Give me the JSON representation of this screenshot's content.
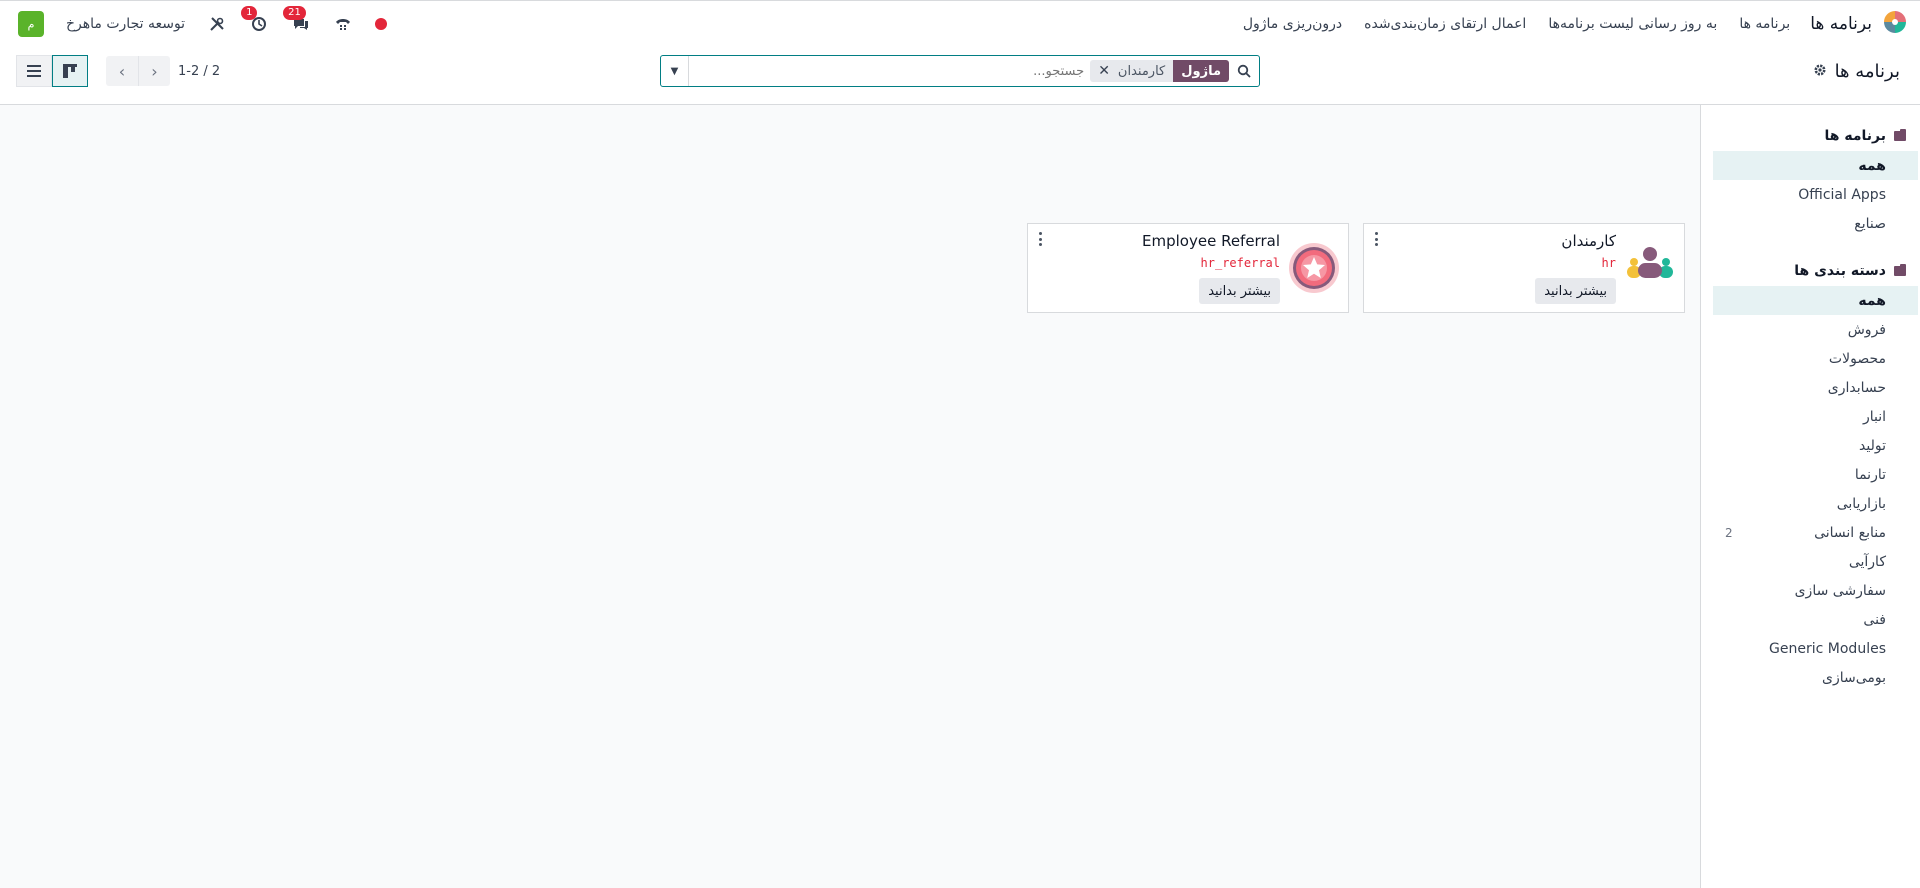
{
  "navbar": {
    "app_title": "برنامه ها",
    "menu": [
      "برنامه ها",
      "به روز رسانی لیست برنامه‌ها",
      "اعمال ارتقای زمان‌بندی‌شده",
      "درون‌ریزی ماژول"
    ],
    "chat_badge": "21",
    "activity_badge": "1",
    "company": "توسعه تجارت ماهرخ",
    "avatar_letter": "م"
  },
  "control": {
    "breadcrumb": "برنامه ها",
    "facet_label": "ماژول",
    "facet_value": "کارمندان",
    "search_placeholder": "جستجو...",
    "pager_value": "1-2 / 2"
  },
  "sidebar": {
    "apps_header": "برنامه ها",
    "apps_items": [
      {
        "label": "همه",
        "count": ""
      },
      {
        "label": "Official Apps",
        "count": ""
      },
      {
        "label": "صنایع",
        "count": ""
      }
    ],
    "cat_header": "دسته بندی ها",
    "cat_items": [
      {
        "label": "همه",
        "count": ""
      },
      {
        "label": "فروش",
        "count": ""
      },
      {
        "label": "محصولات",
        "count": ""
      },
      {
        "label": "حسابداری",
        "count": ""
      },
      {
        "label": "انبار",
        "count": ""
      },
      {
        "label": "تولید",
        "count": ""
      },
      {
        "label": "تارنما",
        "count": ""
      },
      {
        "label": "بازاریابی",
        "count": ""
      },
      {
        "label": "منابع انسانی",
        "count": "2"
      },
      {
        "label": "کارآیی",
        "count": ""
      },
      {
        "label": "سفارشی سازی",
        "count": ""
      },
      {
        "label": "فنی",
        "count": ""
      },
      {
        "label": "Generic Modules",
        "count": ""
      },
      {
        "label": "بومی‌سازی",
        "count": ""
      }
    ]
  },
  "cards": [
    {
      "title": "کارمندان",
      "tech": "hr",
      "button": "بیشتر بدانید",
      "icon": "employees-icon"
    },
    {
      "title": "Employee Referral",
      "tech": "hr_referral",
      "button": "بیشتر بدانید",
      "icon": "referral-star-icon"
    }
  ],
  "colors": {
    "brand": "#714b67",
    "accent": "#017e84",
    "danger": "#e3263a"
  }
}
